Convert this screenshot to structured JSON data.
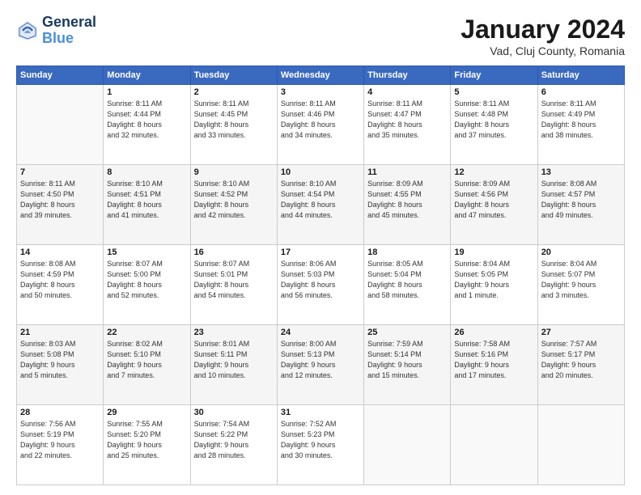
{
  "header": {
    "logo_line1": "General",
    "logo_line2": "Blue",
    "main_title": "January 2024",
    "sub_title": "Vad, Cluj County, Romania"
  },
  "weekdays": [
    "Sunday",
    "Monday",
    "Tuesday",
    "Wednesday",
    "Thursday",
    "Friday",
    "Saturday"
  ],
  "weeks": [
    [
      {
        "day": "",
        "info": ""
      },
      {
        "day": "1",
        "info": "Sunrise: 8:11 AM\nSunset: 4:44 PM\nDaylight: 8 hours\nand 32 minutes."
      },
      {
        "day": "2",
        "info": "Sunrise: 8:11 AM\nSunset: 4:45 PM\nDaylight: 8 hours\nand 33 minutes."
      },
      {
        "day": "3",
        "info": "Sunrise: 8:11 AM\nSunset: 4:46 PM\nDaylight: 8 hours\nand 34 minutes."
      },
      {
        "day": "4",
        "info": "Sunrise: 8:11 AM\nSunset: 4:47 PM\nDaylight: 8 hours\nand 35 minutes."
      },
      {
        "day": "5",
        "info": "Sunrise: 8:11 AM\nSunset: 4:48 PM\nDaylight: 8 hours\nand 37 minutes."
      },
      {
        "day": "6",
        "info": "Sunrise: 8:11 AM\nSunset: 4:49 PM\nDaylight: 8 hours\nand 38 minutes."
      }
    ],
    [
      {
        "day": "7",
        "info": "Sunrise: 8:11 AM\nSunset: 4:50 PM\nDaylight: 8 hours\nand 39 minutes."
      },
      {
        "day": "8",
        "info": "Sunrise: 8:10 AM\nSunset: 4:51 PM\nDaylight: 8 hours\nand 41 minutes."
      },
      {
        "day": "9",
        "info": "Sunrise: 8:10 AM\nSunset: 4:52 PM\nDaylight: 8 hours\nand 42 minutes."
      },
      {
        "day": "10",
        "info": "Sunrise: 8:10 AM\nSunset: 4:54 PM\nDaylight: 8 hours\nand 44 minutes."
      },
      {
        "day": "11",
        "info": "Sunrise: 8:09 AM\nSunset: 4:55 PM\nDaylight: 8 hours\nand 45 minutes."
      },
      {
        "day": "12",
        "info": "Sunrise: 8:09 AM\nSunset: 4:56 PM\nDaylight: 8 hours\nand 47 minutes."
      },
      {
        "day": "13",
        "info": "Sunrise: 8:08 AM\nSunset: 4:57 PM\nDaylight: 8 hours\nand 49 minutes."
      }
    ],
    [
      {
        "day": "14",
        "info": "Sunrise: 8:08 AM\nSunset: 4:59 PM\nDaylight: 8 hours\nand 50 minutes."
      },
      {
        "day": "15",
        "info": "Sunrise: 8:07 AM\nSunset: 5:00 PM\nDaylight: 8 hours\nand 52 minutes."
      },
      {
        "day": "16",
        "info": "Sunrise: 8:07 AM\nSunset: 5:01 PM\nDaylight: 8 hours\nand 54 minutes."
      },
      {
        "day": "17",
        "info": "Sunrise: 8:06 AM\nSunset: 5:03 PM\nDaylight: 8 hours\nand 56 minutes."
      },
      {
        "day": "18",
        "info": "Sunrise: 8:05 AM\nSunset: 5:04 PM\nDaylight: 8 hours\nand 58 minutes."
      },
      {
        "day": "19",
        "info": "Sunrise: 8:04 AM\nSunset: 5:05 PM\nDaylight: 9 hours\nand 1 minute."
      },
      {
        "day": "20",
        "info": "Sunrise: 8:04 AM\nSunset: 5:07 PM\nDaylight: 9 hours\nand 3 minutes."
      }
    ],
    [
      {
        "day": "21",
        "info": "Sunrise: 8:03 AM\nSunset: 5:08 PM\nDaylight: 9 hours\nand 5 minutes."
      },
      {
        "day": "22",
        "info": "Sunrise: 8:02 AM\nSunset: 5:10 PM\nDaylight: 9 hours\nand 7 minutes."
      },
      {
        "day": "23",
        "info": "Sunrise: 8:01 AM\nSunset: 5:11 PM\nDaylight: 9 hours\nand 10 minutes."
      },
      {
        "day": "24",
        "info": "Sunrise: 8:00 AM\nSunset: 5:13 PM\nDaylight: 9 hours\nand 12 minutes."
      },
      {
        "day": "25",
        "info": "Sunrise: 7:59 AM\nSunset: 5:14 PM\nDaylight: 9 hours\nand 15 minutes."
      },
      {
        "day": "26",
        "info": "Sunrise: 7:58 AM\nSunset: 5:16 PM\nDaylight: 9 hours\nand 17 minutes."
      },
      {
        "day": "27",
        "info": "Sunrise: 7:57 AM\nSunset: 5:17 PM\nDaylight: 9 hours\nand 20 minutes."
      }
    ],
    [
      {
        "day": "28",
        "info": "Sunrise: 7:56 AM\nSunset: 5:19 PM\nDaylight: 9 hours\nand 22 minutes."
      },
      {
        "day": "29",
        "info": "Sunrise: 7:55 AM\nSunset: 5:20 PM\nDaylight: 9 hours\nand 25 minutes."
      },
      {
        "day": "30",
        "info": "Sunrise: 7:54 AM\nSunset: 5:22 PM\nDaylight: 9 hours\nand 28 minutes."
      },
      {
        "day": "31",
        "info": "Sunrise: 7:52 AM\nSunset: 5:23 PM\nDaylight: 9 hours\nand 30 minutes."
      },
      {
        "day": "",
        "info": ""
      },
      {
        "day": "",
        "info": ""
      },
      {
        "day": "",
        "info": ""
      }
    ]
  ]
}
